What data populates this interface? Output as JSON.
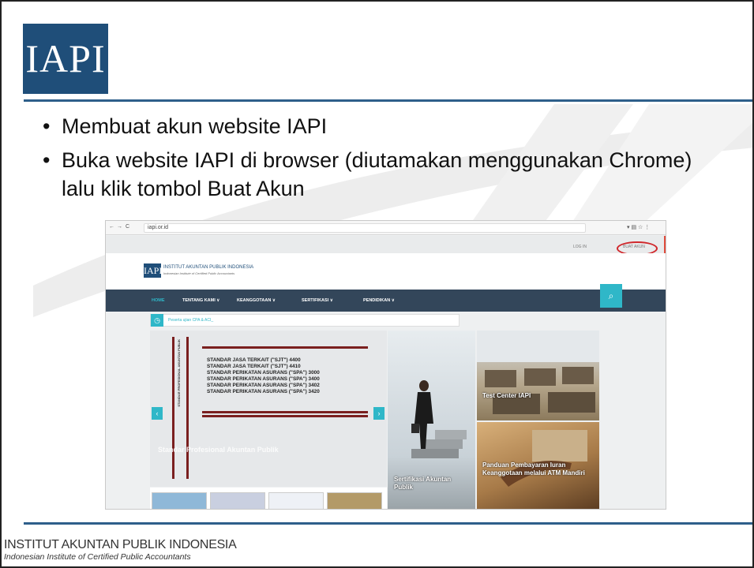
{
  "logo": {
    "text": "IAPI"
  },
  "bullets": [
    "Membuat akun website IAPI",
    "Buka website IAPI di browser (diutamakan menggunakan Chrome) lalu klik tombol Buat Akun"
  ],
  "footer": {
    "name": "INSTITUT AKUNTAN PUBLIK INDONESIA",
    "subtitle": "Indonesian Institute of Certified Public Accountants"
  },
  "screenshot": {
    "url": "iapi.or.id",
    "top_links": [
      "LOG IN",
      "BUAT AKUN"
    ],
    "brand_name": "INSTITUT AKUNTAN PUBLIK INDONESIA",
    "brand_sub": "Indonesian Institute of Certified Public Accountants",
    "logo": "IAPI",
    "nav": [
      "HOME",
      "TENTANG KAMI ∨",
      "KEANGGOTAAN ∨",
      "SERTIFIKASI ∨",
      "PENDIDIKAN ∨"
    ],
    "ticker": "Peserta ujian CPA & ACI_",
    "standards": [
      "STANDAR JASA TERKAIT (\"SJT\") 4400",
      "STANDAR JASA TERKAIT (\"SJT\") 4410",
      "STANDAR PERIKATAN ASURANS (\"SPA\") 3000",
      "STANDAR PERIKATAN ASURANS (\"SPA\") 3400",
      "STANDAR PERIKATAN ASURANS (\"SPA\") 3402",
      "STANDAR PERIKATAN ASURANS (\"SPA\") 3420"
    ],
    "vertical_label": "STANDAR PROFESIONAL AKUNTAN PUBLIK",
    "slide_caption": "Standar Profesional Akuntan Publik",
    "panels": {
      "certification": "Sertifikasi Akuntan Publik",
      "test_center": "Test Center IAPI",
      "payment": "Panduan Pembayaran Iuran Keanggotaan melalui ATM Mandiri"
    }
  }
}
